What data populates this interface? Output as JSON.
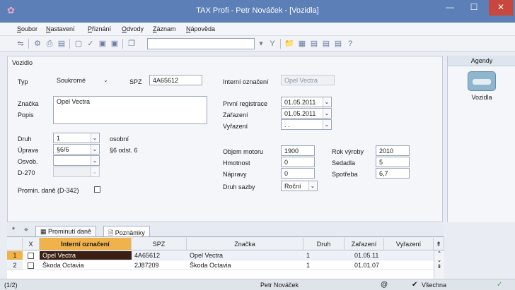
{
  "window": {
    "title": "TAX Profi - Petr Nováček - [Vozidla]"
  },
  "menu": [
    "Soubor",
    "Nastavení",
    "Přiznání",
    "Odvody",
    "Záznam",
    "Nápověda"
  ],
  "form": {
    "section_title": "Vozidlo",
    "typ_label": "Typ",
    "typ_value": "Soukromé",
    "spz_label": "SPZ",
    "spz_value": "4A65612",
    "znacka_label": "Značka",
    "znacka_value": "Opel Vectra",
    "popis_label": "Popis",
    "druh_label": "Druh",
    "druh_value": "1",
    "druh_desc": "osobní",
    "uprava_label": "Úprava",
    "uprava_value": "§6/6",
    "uprava_desc": "§6 odst. 6",
    "osvob_label": "Osvob.",
    "d270_label": "D-270",
    "promin_label": "Promin. daně (D-342)",
    "interni_label": "Interní označení",
    "interni_value": "Opel Vectra",
    "prvni_label": "První registrace",
    "prvni_value": "01.05.2011",
    "zarazeni_label": "Zařazení",
    "zarazeni_value": "01.05.2011",
    "vyrazeni_label": "Vyřazení",
    "vyrazeni_value": ". .",
    "objem_label": "Objem motoru",
    "objem_value": "1900",
    "hmotnost_label": "Hmotnost",
    "hmotnost_value": "0",
    "napravy_label": "Nápravy",
    "napravy_value": "0",
    "sazba_label": "Druh sazby",
    "sazba_value": "Roční",
    "rok_label": "Rok výroby",
    "rok_value": "2010",
    "sedadla_label": "Sedadla",
    "sedadla_value": "5",
    "spotreba_label": "Spotřeba",
    "spotreba_value": "6,7"
  },
  "agendy": {
    "title": "Agendy",
    "item": "Vozidla"
  },
  "tabs": {
    "prominuti": "Prominutí daně",
    "poznamky": "Poznámky"
  },
  "grid": {
    "headers": [
      "X",
      "Interní označení",
      "SPZ",
      "Značka",
      "Druh",
      "Zařazení",
      "Vyřazení"
    ],
    "rows": [
      {
        "num": "1",
        "interni": "Opel Vectra",
        "spz": "4A65612",
        "znacka": "Opel Vectra",
        "druh": "1",
        "zarazeni": "01.05.11",
        "vyrazeni": ""
      },
      {
        "num": "2",
        "interni": "Škoda Octavia",
        "spz": "2J87209",
        "znacka": "Škoda Octavia",
        "druh": "1",
        "zarazeni": "01.01.07",
        "vyrazeni": ""
      }
    ]
  },
  "status": {
    "record": "(1/2)",
    "user": "Petr Nováček",
    "filter": "Všechna"
  },
  "colors": {
    "titlebar": "#5b7fb6",
    "selected_row": "#3a1f12",
    "header_highlight": "#f0b24a"
  }
}
